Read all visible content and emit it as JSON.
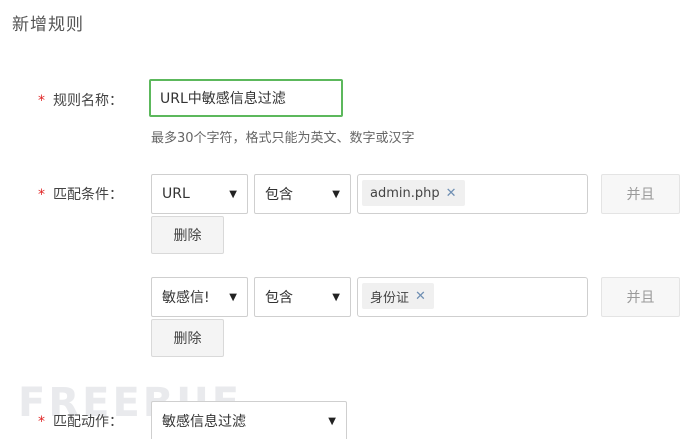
{
  "page_title": "新增规则",
  "rule_name": {
    "label": "规则名称：",
    "value": "URL中敏感信息过滤",
    "hint": "最多30个字符，格式只能为英文、数字或汉字"
  },
  "conditions": {
    "label": "匹配条件：",
    "rows": [
      {
        "field": "URL",
        "operator": "包含",
        "tags": [
          "admin.php"
        ],
        "and_label": "并且",
        "delete_label": "删除"
      },
      {
        "field": "敏感信!",
        "operator": "包含",
        "tags": [
          "身份证"
        ],
        "and_label": "并且",
        "delete_label": "删除"
      }
    ]
  },
  "action": {
    "label": "匹配动作：",
    "value": "敏感信息过滤"
  },
  "required_mark": "*",
  "tag_remove_glyph": "✕",
  "caret_glyph": "▼",
  "watermark": "FREEBUF",
  "colors": {
    "required": "#e02424",
    "input_focus_border": "#5cb85c",
    "tag_remove": "#6f8fb3"
  }
}
